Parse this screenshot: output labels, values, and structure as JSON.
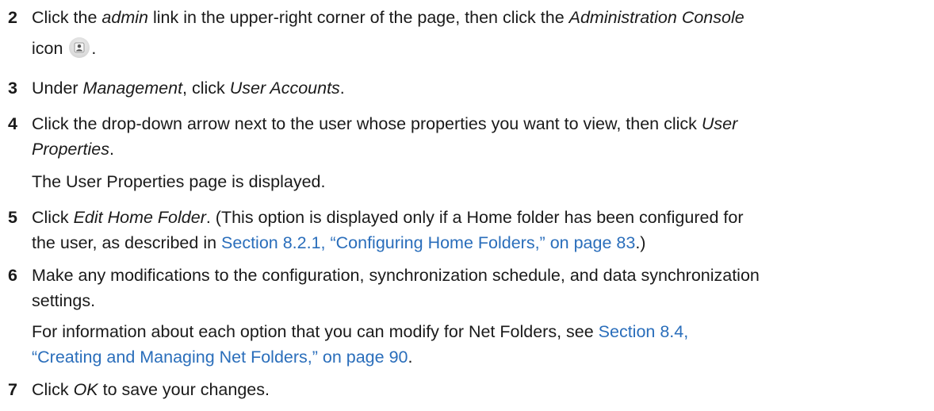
{
  "steps": [
    {
      "num": "2",
      "t1": "Click the ",
      "e1": "admin",
      "t2": " link in the upper-right corner of the page, then click the ",
      "e2": "Administration Console",
      "t3": "icon ",
      "icon": "admin-console-icon",
      "t4": "."
    },
    {
      "num": "3",
      "t1": "Under ",
      "e1": "Management",
      "t2": ", click ",
      "e2": "User Accounts",
      "t3": "."
    },
    {
      "num": "4",
      "t1": "Click the drop-down arrow next to the user whose properties you want to view, then click ",
      "e1": "User",
      "e2": "Properties",
      "t2": ".",
      "result": "The User Properties page is displayed."
    },
    {
      "num": "5",
      "t1": "Click ",
      "e1": "Edit Home Folder",
      "t2": ". (This option is displayed only if a Home folder has been configured for",
      "t3": "the user, as described in ",
      "link": "Section 8.2.1, “Configuring Home Folders,” on page 83",
      "t4": ".)"
    },
    {
      "num": "6",
      "l1": "Make any modifications to the configuration, synchronization schedule, and data synchronization",
      "l2": "settings.",
      "info1": "For information about each option that you can modify for Net Folders, see ",
      "link1": "Section 8.4,",
      "link2": "“Creating and Managing Net Folders,” on page 90",
      "info2": "."
    },
    {
      "num": "7",
      "t1": "Click ",
      "e1": "OK",
      "t2": " to save your changes."
    }
  ]
}
